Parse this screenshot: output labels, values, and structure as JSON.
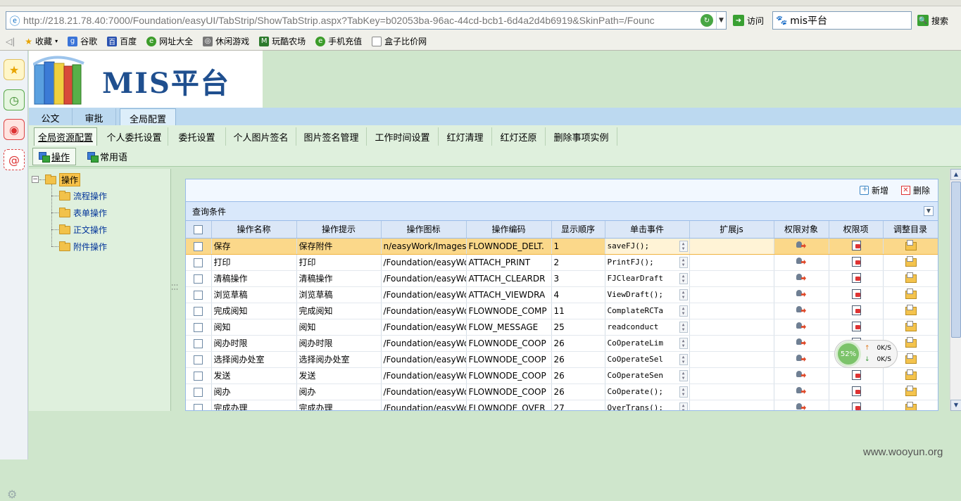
{
  "browser": {
    "url": "http://218.21.78.40:7000/Foundation/easyUI/TabStrip/ShowTabStrip.aspx?TabKey=b02053ba-96ac-44cd-bcb1-6d4a2d4b6919&SkinPath=/Founc",
    "url_host": "218.21.78.40",
    "visit_label": "访问",
    "search_value": "mis平台",
    "search_label": "搜索",
    "favorites_label": "收藏",
    "bookmarks": [
      "谷歌",
      "百度",
      "网址大全",
      "休闲游戏",
      "玩酷农场",
      "手机充值",
      "盒子比价网"
    ]
  },
  "app": {
    "logo_text": "MIS平台",
    "main_tabs": [
      "公文",
      "审批",
      "全局配置"
    ],
    "main_tab_active": "全局配置",
    "sub_tabs": [
      "全局资源配置",
      "个人委托设置",
      "委托设置",
      "个人图片签名",
      "图片签名管理",
      "工作时间设置",
      "红灯清理",
      "红灯还原",
      "删除事项实例"
    ],
    "sub_tab_active": "全局资源配置",
    "third_tabs": [
      "操作",
      "常用语"
    ],
    "third_tab_active": "操作",
    "tree": {
      "root": "操作",
      "children": [
        "流程操作",
        "表单操作",
        "正文操作",
        "附件操作"
      ]
    },
    "toolbar": {
      "add_label": "新增",
      "delete_label": "删除"
    },
    "query_label": "查询条件",
    "columns": [
      "操作名称",
      "操作提示",
      "操作图标",
      "操作编码",
      "显示顺序",
      "单击事件",
      "扩展js",
      "权限对象",
      "权限项",
      "调整目录"
    ],
    "rows": [
      {
        "name": "保存",
        "tip": "保存附件",
        "icon": "n/easyWork/Images.",
        "code": "FLOWNODE_DELT.",
        "order": "1",
        "event": "saveFJ();",
        "ext": ""
      },
      {
        "name": "打印",
        "tip": "打印",
        "icon": "/Foundation/easyWo",
        "code": "ATTACH_PRINT",
        "order": "2",
        "event": "PrintFJ();",
        "ext": ""
      },
      {
        "name": "清稿操作",
        "tip": "清稿操作",
        "icon": "/Foundation/easyWo",
        "code": "ATTACH_CLEARDR",
        "order": "3",
        "event": "FJClearDraft",
        "ext": ""
      },
      {
        "name": "浏览草稿",
        "tip": "浏览草稿",
        "icon": "/Foundation/easyWo",
        "code": "ATTACH_VIEWDRA",
        "order": "4",
        "event": "ViewDraft();",
        "ext": ""
      },
      {
        "name": "完成阅知",
        "tip": "完成阅知",
        "icon": "/Foundation/easyWo",
        "code": "FLOWNODE_COMP",
        "order": "11",
        "event": "ComplateRCTa",
        "ext": ""
      },
      {
        "name": "阅知",
        "tip": "阅知",
        "icon": "/Foundation/easyWo",
        "code": "FLOW_MESSAGE",
        "order": "25",
        "event": "readconduct",
        "ext": ""
      },
      {
        "name": "阅办时限",
        "tip": "阅办时限",
        "icon": "/Foundation/easyWo",
        "code": "FLOWNODE_COOP",
        "order": "26",
        "event": "CoOperateLim",
        "ext": ""
      },
      {
        "name": "选择阅办处室",
        "tip": "选择阅办处室",
        "icon": "/Foundation/easyWo",
        "code": "FLOWNODE_COOP",
        "order": "26",
        "event": "CoOperateSel",
        "ext": ""
      },
      {
        "name": "发送",
        "tip": "发送",
        "icon": "/Foundation/easyWo",
        "code": "FLOWNODE_COOP",
        "order": "26",
        "event": "CoOperateSen",
        "ext": ""
      },
      {
        "name": "阅办",
        "tip": "阅办",
        "icon": "/Foundation/easyWo",
        "code": "FLOWNODE_COOP",
        "order": "26",
        "event": "CoOperate();",
        "ext": ""
      },
      {
        "name": "完成办理",
        "tip": "完成办理",
        "icon": "/Foundation/easyWo",
        "code": "FLOWNODE_OVER",
        "order": "27",
        "event": "OverTrans();",
        "ext": ""
      }
    ],
    "net_widget": {
      "percent": "52%",
      "up": "0K/S",
      "down": "0K/S"
    }
  },
  "watermark": "www.wooyun.org",
  "colors": {
    "selected_row": "#fbd88a",
    "page_bg": "#cfe6cc",
    "logo_text": "#1f4f8f"
  }
}
